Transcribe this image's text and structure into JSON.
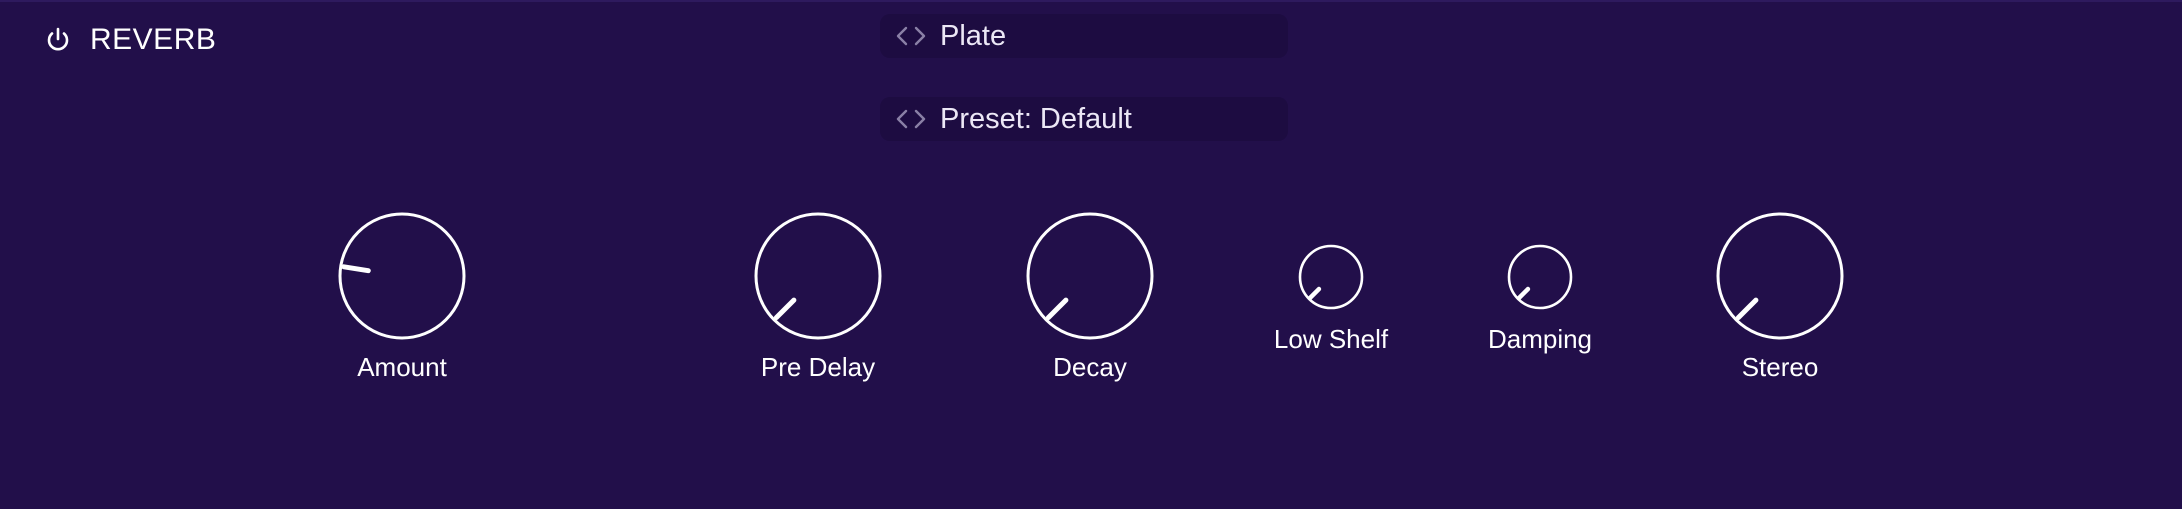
{
  "header": {
    "title": "REVERB",
    "power_icon": "power-icon"
  },
  "type_selector": {
    "value": "Plate",
    "nav_icon": "prev-next-arrows-icon"
  },
  "preset_selector": {
    "value": "Preset: Default",
    "nav_icon": "prev-next-arrows-icon"
  },
  "knobs": [
    {
      "id": "amount",
      "label": "Amount",
      "value": 0.2
    },
    {
      "id": "pre-delay",
      "label": "Pre Delay",
      "value": 0.0
    },
    {
      "id": "decay",
      "label": "Decay",
      "value": 0.0
    },
    {
      "id": "low-shelf",
      "label": "Low Shelf",
      "value": 0.0
    },
    {
      "id": "damping",
      "label": "Damping",
      "value": 0.0
    },
    {
      "id": "stereo",
      "label": "Stereo",
      "value": 0.0
    }
  ],
  "colors": {
    "background": "#220f4a",
    "selector_background": "#1d0c41",
    "arrow": "#8a80a6",
    "foreground": "#ffffff"
  }
}
